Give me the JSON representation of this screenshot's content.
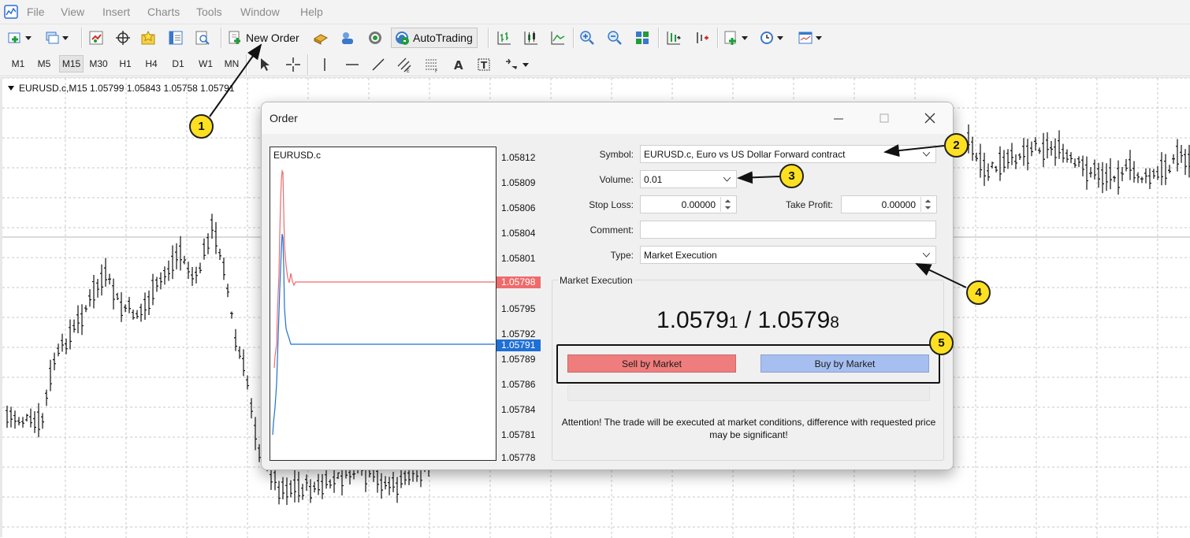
{
  "menu": [
    "File",
    "View",
    "Insert",
    "Charts",
    "Tools",
    "Window",
    "Help"
  ],
  "toolbar": {
    "new_order_label": "New Order",
    "autotrading_label": "AutoTrading"
  },
  "timeframes": [
    "M1",
    "M5",
    "M15",
    "M30",
    "H1",
    "H4",
    "D1",
    "W1",
    "MN"
  ],
  "active_timeframe": "M15",
  "chart": {
    "header": "EURUSD.c,M15  1.05799 1.05843 1.05758 1.05791"
  },
  "dialog": {
    "title": "Order",
    "mini_chart": {
      "symbol": "EURUSD.c",
      "price_labels": [
        "1.05812",
        "1.05809",
        "1.05806",
        "1.05804",
        "1.05801",
        "1.05795",
        "1.05792",
        "1.05789",
        "1.05786",
        "1.05784",
        "1.05781",
        "1.05778"
      ],
      "ask_tag": "1.05798",
      "bid_tag": "1.05791",
      "ask_color": "#ef6b6b",
      "bid_color": "#1f6fd6"
    },
    "form": {
      "symbol_label": "Symbol:",
      "symbol_value": "EURUSD.c, Euro vs US Dollar Forward contract",
      "volume_label": "Volume:",
      "volume_value": "0.01",
      "stop_loss_label": "Stop Loss:",
      "stop_loss_value": "0.00000",
      "take_profit_label": "Take Profit:",
      "take_profit_value": "0.00000",
      "comment_label": "Comment:",
      "comment_value": "",
      "type_label": "Type:",
      "type_value": "Market Execution"
    },
    "market_execution": {
      "legend": "Market Execution",
      "bid_main": "1.0579",
      "bid_small": "1",
      "separator": " / ",
      "ask_main": "1.0579",
      "ask_small": "8",
      "sell_label": "Sell by Market",
      "buy_label": "Buy by Market",
      "sell_color": "#f07d7d",
      "buy_color": "#a6bff0",
      "attention": "Attention! The trade will be executed at market conditions, difference with requested price may be significant!"
    }
  },
  "callouts": [
    "1",
    "2",
    "3",
    "4",
    "5"
  ],
  "callout_color": "#fde021"
}
